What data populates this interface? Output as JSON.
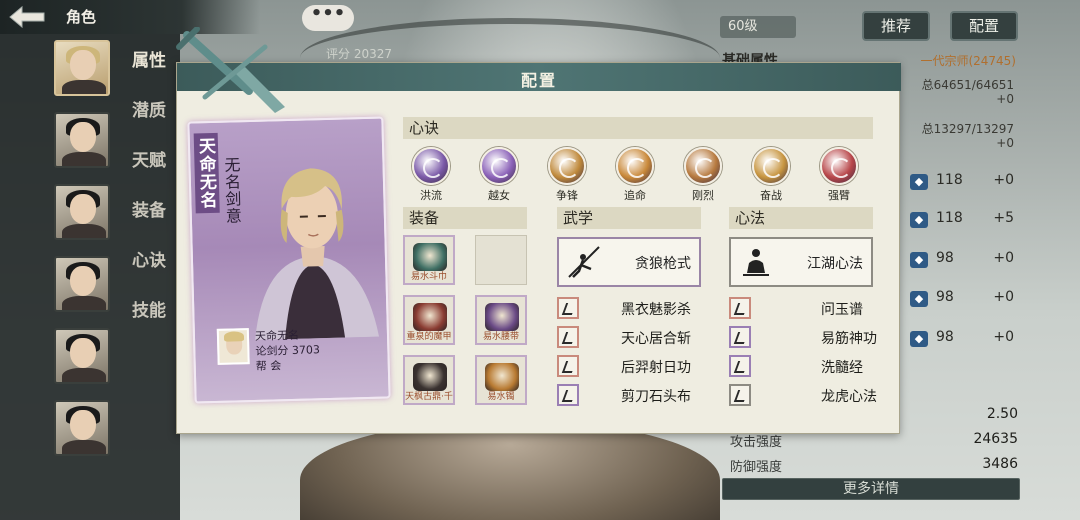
{
  "header": {
    "title": "角色",
    "level": "60级",
    "btn_recommend": "推荐",
    "btn_config": "配置"
  },
  "score_strip": "评分 20327",
  "nav_tabs": [
    "属性",
    "潜质",
    "天赋",
    "装备",
    "心诀",
    "技能"
  ],
  "stats": {
    "head": "基础属性",
    "rank": "一代宗师(24745)",
    "hp": "总64651/64651",
    "hp_add": "+0",
    "mp": "总13297/13297",
    "mp_add": "+0",
    "attrs": [
      {
        "v1": "118",
        "v2": "+0"
      },
      {
        "v1": "118",
        "v2": "+5"
      },
      {
        "v1": "98",
        "v2": "+0"
      },
      {
        "v1": "98",
        "v2": "+0"
      },
      {
        "v1": "98",
        "v2": "+0"
      }
    ],
    "rows": [
      {
        "label": "",
        "value": "2.50"
      },
      {
        "label": "攻击强度",
        "value": "24635"
      },
      {
        "label": "防御强度",
        "value": "3486"
      }
    ],
    "more": "更多详情"
  },
  "modal": {
    "title": "配置",
    "character": {
      "name": "天命无名",
      "title": "无名剑意",
      "info_name": "天命无名",
      "info_score": "论剑分 3703",
      "info_guild": "帮 会"
    },
    "xinjue": {
      "header": "心诀",
      "skills": [
        {
          "name": "洪流",
          "color": "#7b5aa8"
        },
        {
          "name": "越女",
          "color": "#8b62b8"
        },
        {
          "name": "争锋",
          "color": "#c08a3c"
        },
        {
          "name": "追命",
          "color": "#c9893a"
        },
        {
          "name": "刚烈",
          "color": "#b77a3f"
        },
        {
          "name": "奋战",
          "color": "#c79540"
        },
        {
          "name": "强臂",
          "color": "#b8474a"
        }
      ]
    },
    "equip": {
      "header": "装备",
      "items": [
        {
          "name": "易水斗巾",
          "color": "#3f6f64"
        },
        {
          "name": "",
          "color": ""
        },
        {
          "name": "重泉的魔甲",
          "color": "#8a3c32"
        },
        {
          "name": "易水腰带",
          "color": "#6a4a86"
        },
        {
          "name": "天枫古鼎·千",
          "color": "#3a3230"
        },
        {
          "name": "易水镯",
          "color": "#b87a32"
        }
      ]
    },
    "wuxue": {
      "header": "武学",
      "main": "贪狼枪式",
      "subs": [
        "黑衣魅影杀",
        "天心居合斩",
        "后羿射日功",
        "剪刀石头布"
      ]
    },
    "xinfa": {
      "header": "心法",
      "main": "江湖心法",
      "subs": [
        "问玉谱",
        "易筋神功",
        "洗髓经",
        "龙虎心法"
      ]
    }
  }
}
